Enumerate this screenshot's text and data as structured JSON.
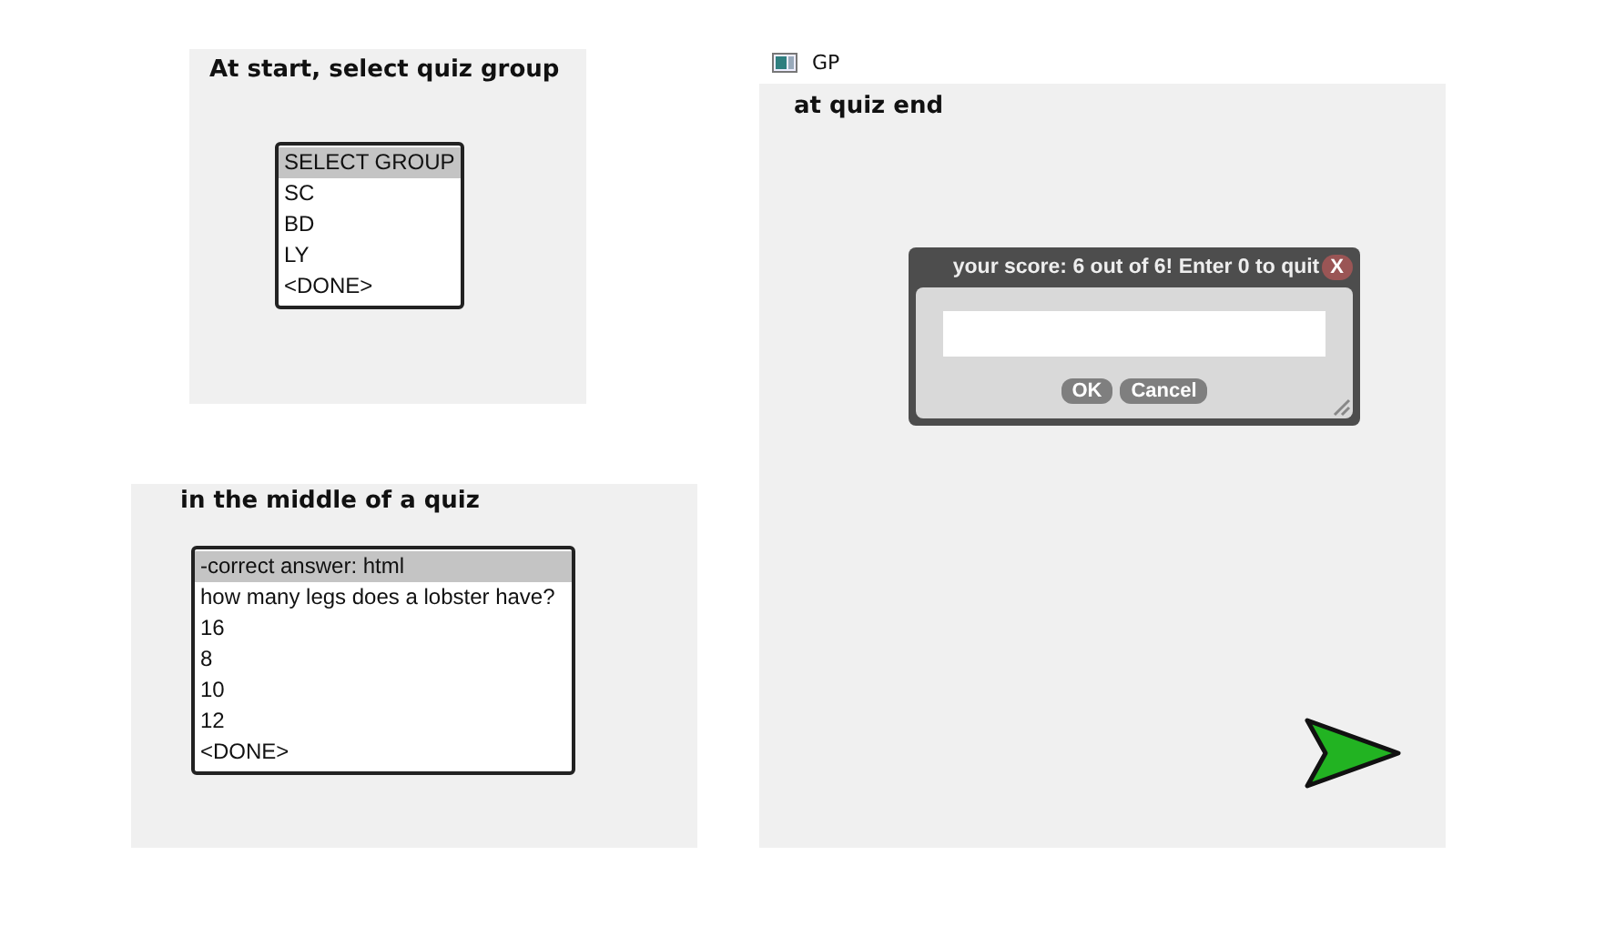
{
  "panels": [
    {
      "heading": "At start, select quiz group",
      "list": [
        {
          "label": "SELECT GROUP",
          "selected": true
        },
        {
          "label": "SC",
          "selected": false
        },
        {
          "label": "BD",
          "selected": false
        },
        {
          "label": "LY",
          "selected": false
        },
        {
          "label": "<DONE>",
          "selected": false
        }
      ]
    },
    {
      "heading": "in the middle of a quiz",
      "list": [
        {
          "label": "-correct answer: html",
          "selected": true
        },
        {
          "label": "how many legs does a lobster have?",
          "selected": false
        },
        {
          "label": "16",
          "selected": false
        },
        {
          "label": "8",
          "selected": false
        },
        {
          "label": "10",
          "selected": false
        },
        {
          "label": "12",
          "selected": false
        },
        {
          "label": "<DONE>",
          "selected": false
        }
      ]
    }
  ],
  "window": {
    "title": "GP",
    "heading": "at quiz end",
    "dialog": {
      "title": "your score: 6 out of 6! Enter 0 to quit",
      "close": "X",
      "buttons": [
        "OK",
        "Cancel"
      ]
    }
  }
}
